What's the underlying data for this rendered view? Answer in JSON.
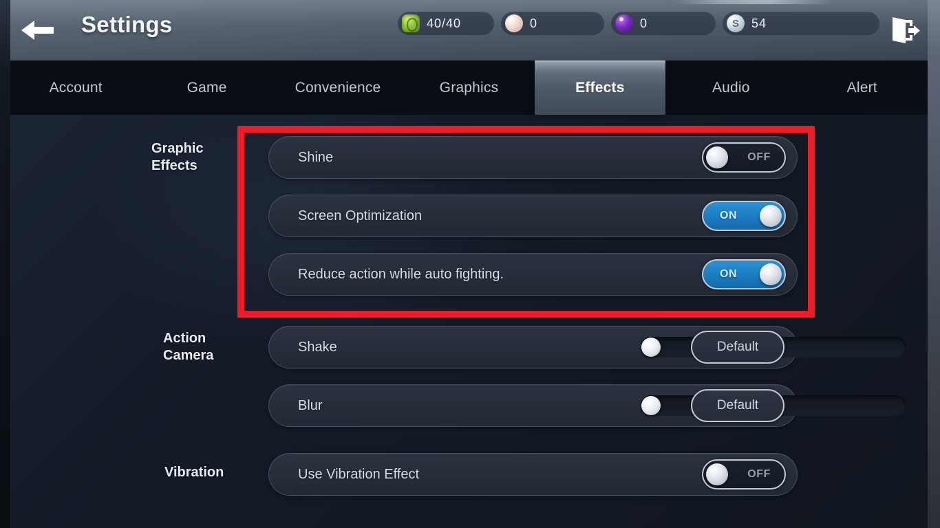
{
  "header": {
    "back_icon": "arrow-left-icon",
    "title": "Settings",
    "exit_icon": "exit-door-icon",
    "currencies": [
      {
        "icon": "energy-icon",
        "value": "40/40"
      },
      {
        "icon": "pearl-icon",
        "value": "0"
      },
      {
        "icon": "gem-icon",
        "value": "0"
      },
      {
        "icon": "coin-icon",
        "value": "54"
      }
    ]
  },
  "tabs": [
    {
      "label": "Account",
      "active": false
    },
    {
      "label": "Game",
      "active": false
    },
    {
      "label": "Convenience",
      "active": false
    },
    {
      "label": "Graphics",
      "active": false
    },
    {
      "label": "Effects",
      "active": true
    },
    {
      "label": "Audio",
      "active": false
    },
    {
      "label": "Alert",
      "active": false
    }
  ],
  "sections": {
    "graphic_effects": {
      "label": "Graphic\nEffects",
      "label_line1": "Graphic",
      "label_line2": "Effects",
      "rows": [
        {
          "label": "Shine",
          "state": "OFF"
        },
        {
          "label": "Screen Optimization",
          "state": "ON"
        },
        {
          "label": "Reduce action while auto fighting.",
          "state": "ON"
        }
      ]
    },
    "action_camera": {
      "label_line1": "Action",
      "label_line2": "Camera",
      "rows": [
        {
          "label": "Shake",
          "value": "0",
          "percent": 0,
          "button": "Default"
        },
        {
          "label": "Blur",
          "value": "0",
          "percent": 0,
          "button": "Default"
        }
      ]
    },
    "vibration": {
      "label_line1": "Vibration",
      "rows": [
        {
          "label": "Use Vibration Effect",
          "state": "OFF"
        }
      ]
    }
  },
  "annotation": {
    "color": "#ef1b26",
    "shape": "rectangle-highlight"
  }
}
